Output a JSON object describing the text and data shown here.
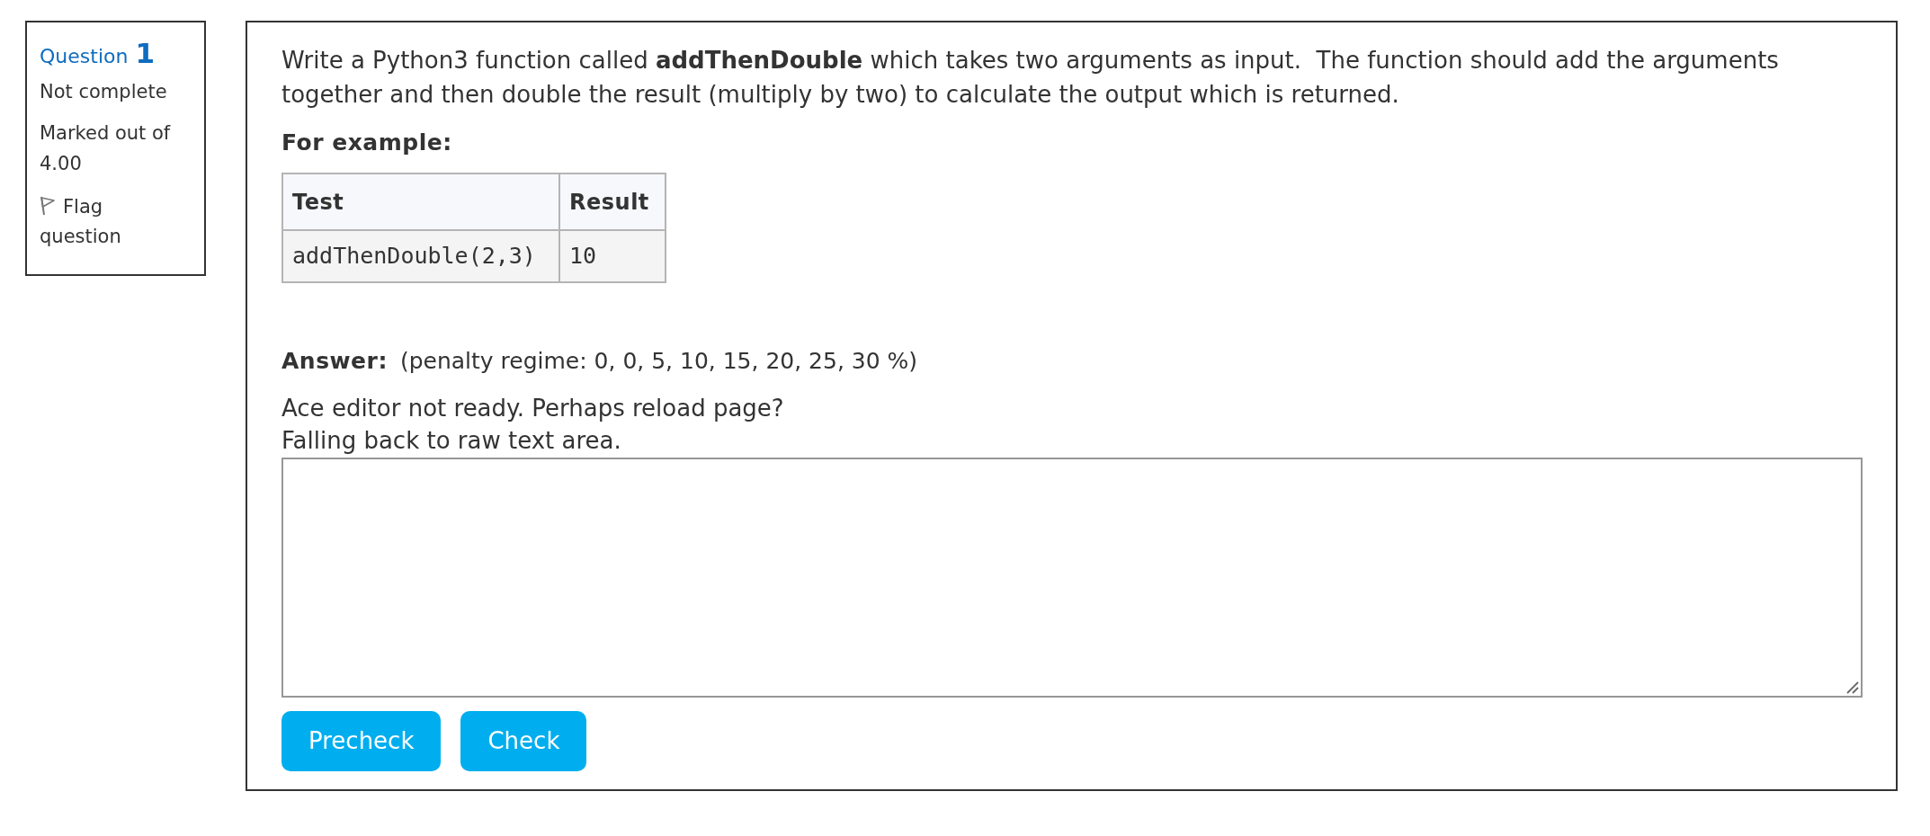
{
  "question_info": {
    "label": "Question",
    "number": "1",
    "status": "Not complete",
    "mark": "Marked out of 4.00",
    "flag": {
      "label": "Flag question",
      "flagged": false
    }
  },
  "question": {
    "text": "Write a Python3 function called **addThenDouble** which takes two arguments as input.  The function should add the arguments together and then double the result (multiply by two) to calculate the output which is returned.",
    "example_heading": "For example:",
    "table": {
      "columns": [
        "Test",
        "Result"
      ],
      "rows": [
        [
          "addThenDouble(2,3)",
          "10"
        ]
      ]
    }
  },
  "answer": {
    "label": "Answer:",
    "penalty": "(penalty regime: 0, 0, 5, 10, 15, 20, 25, 30 %)",
    "notice_lines": [
      "Ace editor not ready. Perhaps reload page?",
      "Falling back to raw text area."
    ]
  },
  "buttons": [
    "Precheck",
    "Check"
  ]
}
